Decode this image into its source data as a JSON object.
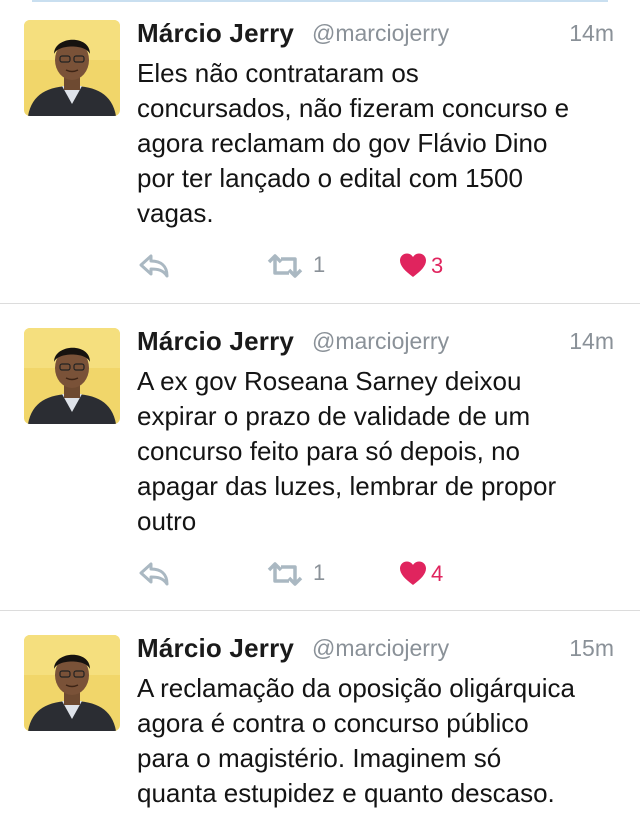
{
  "tweets": [
    {
      "name": "Márcio Jerry",
      "handle": "@marciojerry",
      "time": "14m",
      "lines": [
        "Eles não contrataram os",
        "concursados, não fizeram concurso e",
        "agora reclamam do gov Flávio Dino",
        "por ter lançado o edital com 1500",
        "vagas."
      ],
      "retweets": "1",
      "likes": "3"
    },
    {
      "name": "Márcio Jerry",
      "handle": "@marciojerry",
      "time": "14m",
      "lines": [
        "A ex gov Roseana Sarney deixou",
        "expirar o prazo de validade de um",
        "concurso feito para só depois, no",
        "apagar das luzes, lembrar de propor",
        "outro"
      ],
      "retweets": "1",
      "likes": "4"
    },
    {
      "name": "Márcio Jerry",
      "handle": "@marciojerry",
      "time": "15m",
      "lines": [
        "A reclamação da oposição oligárquica",
        "agora é contra o concurso público",
        "para o magistério. Imaginem só",
        "quanta estupidez e quanto descaso."
      ]
    }
  ],
  "colors": {
    "name": "#1a1a1a",
    "muted": "#8a9198",
    "like": "#e0245e",
    "action_icon": "#aab8c2"
  },
  "icons": {
    "reply": "reply-icon",
    "retweet": "retweet-icon",
    "like": "heart-icon"
  }
}
